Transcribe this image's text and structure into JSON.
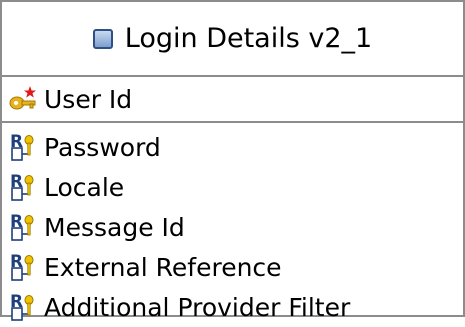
{
  "entity": {
    "title": "Login Details v2_1",
    "primary_key": {
      "label": "User Id",
      "icon": "primary-key-icon"
    },
    "attributes": [
      {
        "label": "Password",
        "icon": "attribute-icon"
      },
      {
        "label": "Locale",
        "icon": "attribute-icon"
      },
      {
        "label": "Message Id",
        "icon": "attribute-icon"
      },
      {
        "label": "External Reference",
        "icon": "attribute-icon"
      },
      {
        "label": "Additional Provider Filter",
        "icon": "attribute-icon"
      }
    ],
    "colors": {
      "border": "#8c8c8c",
      "entity_icon": "#7f9fcd",
      "key_gold": "#e8b21c",
      "key_star": "#e01a1a",
      "attr_blue": "#1f3f7a",
      "attr_yellow": "#f2c200"
    }
  }
}
